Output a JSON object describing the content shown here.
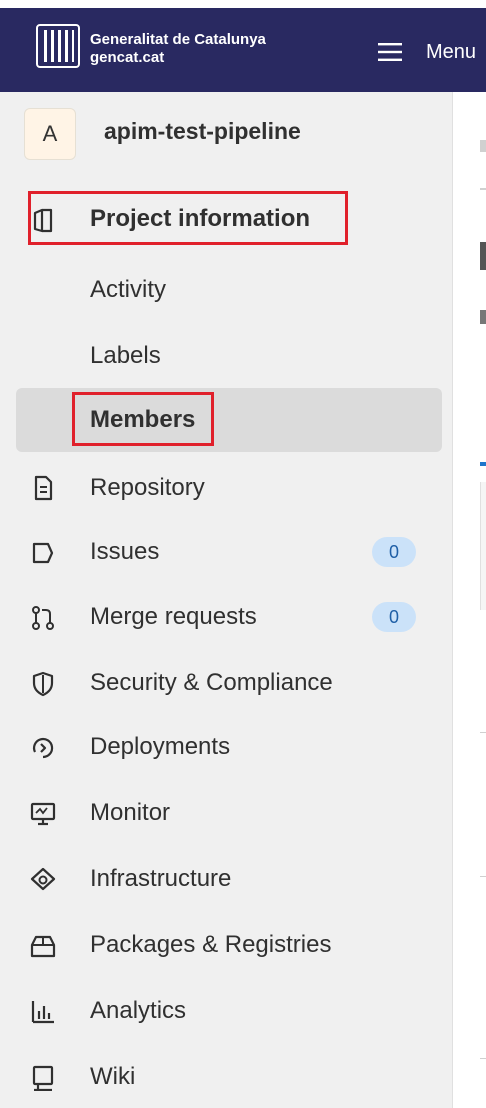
{
  "header": {
    "org_name": "Generalitat de Catalunya",
    "org_domain": "gencat.cat",
    "menu_label": "Menu",
    "logo_icon": "gencat-logo-icon",
    "menu_icon": "hamburger-icon"
  },
  "project": {
    "avatar_letter": "A",
    "name": "apim-test-pipeline"
  },
  "nav": {
    "project_information": "Project information",
    "sub_items": {
      "activity": "Activity",
      "labels": "Labels",
      "members": "Members"
    },
    "repository": "Repository",
    "issues": "Issues",
    "issues_count": "0",
    "merge_requests": "Merge requests",
    "merge_requests_count": "0",
    "security": "Security & Compliance",
    "deployments": "Deployments",
    "monitor": "Monitor",
    "infrastructure": "Infrastructure",
    "packages": "Packages & Registries",
    "analytics": "Analytics",
    "wiki": "Wiki"
  },
  "colors": {
    "topbar": "#292961",
    "sidebar_bg": "#f0f0f0",
    "active_bg": "#dbdbdb",
    "highlight": "#e0202b",
    "badge_bg": "#cbe2f9"
  }
}
